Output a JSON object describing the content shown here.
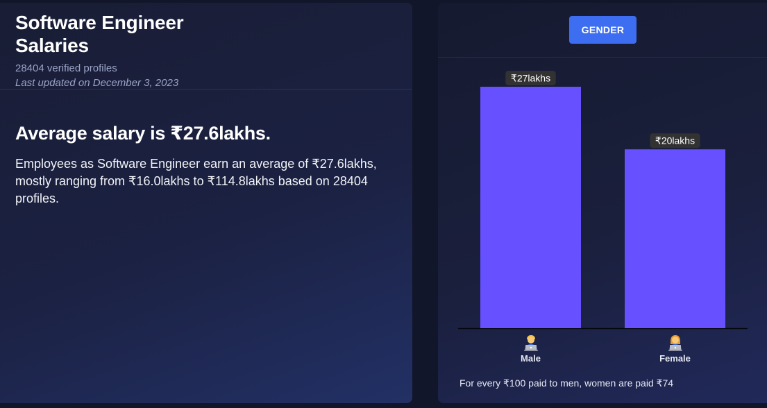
{
  "salary_card": {
    "title_line1": "Software Engineer",
    "title_line2": "Salaries",
    "verified_profiles": "28404 verified profiles",
    "last_updated": "Last updated on December 3, 2023",
    "average_heading": "Average salary is ₹27.6lakhs.",
    "description": "Employees as Software Engineer earn an average of ₹27.6lakhs, mostly ranging from ₹16.0lakhs to ₹114.8lakhs based on 28404 profiles."
  },
  "gender_card": {
    "tab_label": "GENDER",
    "footnote": "For every ₹100 paid to men, women are paid ₹74"
  },
  "colors": {
    "bar": "#6750ff",
    "button": "#3d6df0",
    "value_pill": "#323232"
  },
  "chart_data": {
    "type": "bar",
    "categories": [
      "Male",
      "Female"
    ],
    "values": [
      27,
      20
    ],
    "value_labels": [
      "₹27lakhs",
      "₹20lakhs"
    ],
    "icons": [
      "male-worker-icon",
      "female-worker-icon"
    ],
    "unit": "lakhs",
    "ylim": [
      0,
      27
    ],
    "grid": false
  }
}
